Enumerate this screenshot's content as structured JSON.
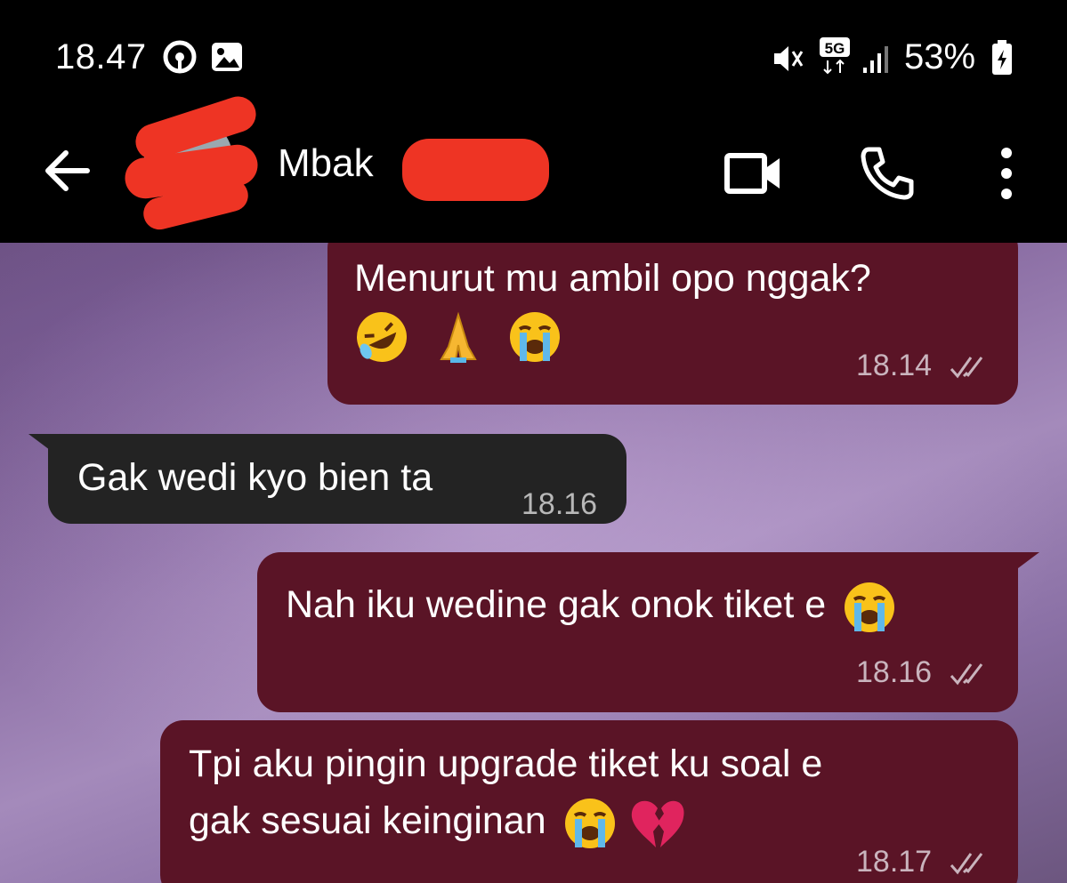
{
  "status_bar": {
    "time": "18.47",
    "network": "5G",
    "battery": "53%"
  },
  "header": {
    "contact_name": "Mbak",
    "icons": [
      "back-arrow-icon",
      "video-call-icon",
      "phone-icon",
      "more-vert-icon"
    ]
  },
  "messages": [
    {
      "direction": "outgoing",
      "line1": "Menurut mu ambil opo nggak?",
      "emojis": [
        "rolling-laughing",
        "folded-hands",
        "loudly-crying"
      ],
      "time": "18.14",
      "status": "read"
    },
    {
      "direction": "incoming",
      "line1": "Gak wedi kyo bien ta",
      "time": "18.16"
    },
    {
      "direction": "outgoing",
      "line1": "Nah iku wedine gak onok tiket e",
      "emojis": [
        "loudly-crying"
      ],
      "time": "18.16",
      "status": "read"
    },
    {
      "direction": "outgoing",
      "line1": "Tpi aku pingin upgrade tiket ku soal e",
      "line2": "gak sesuai keinginan",
      "emojis": [
        "loudly-crying",
        "broken-heart"
      ],
      "time": "18.17",
      "status": "read"
    }
  ],
  "colors": {
    "outgoing_bubble": "#5a1426",
    "incoming_bubble": "#232323",
    "redaction": "#ee3424"
  }
}
